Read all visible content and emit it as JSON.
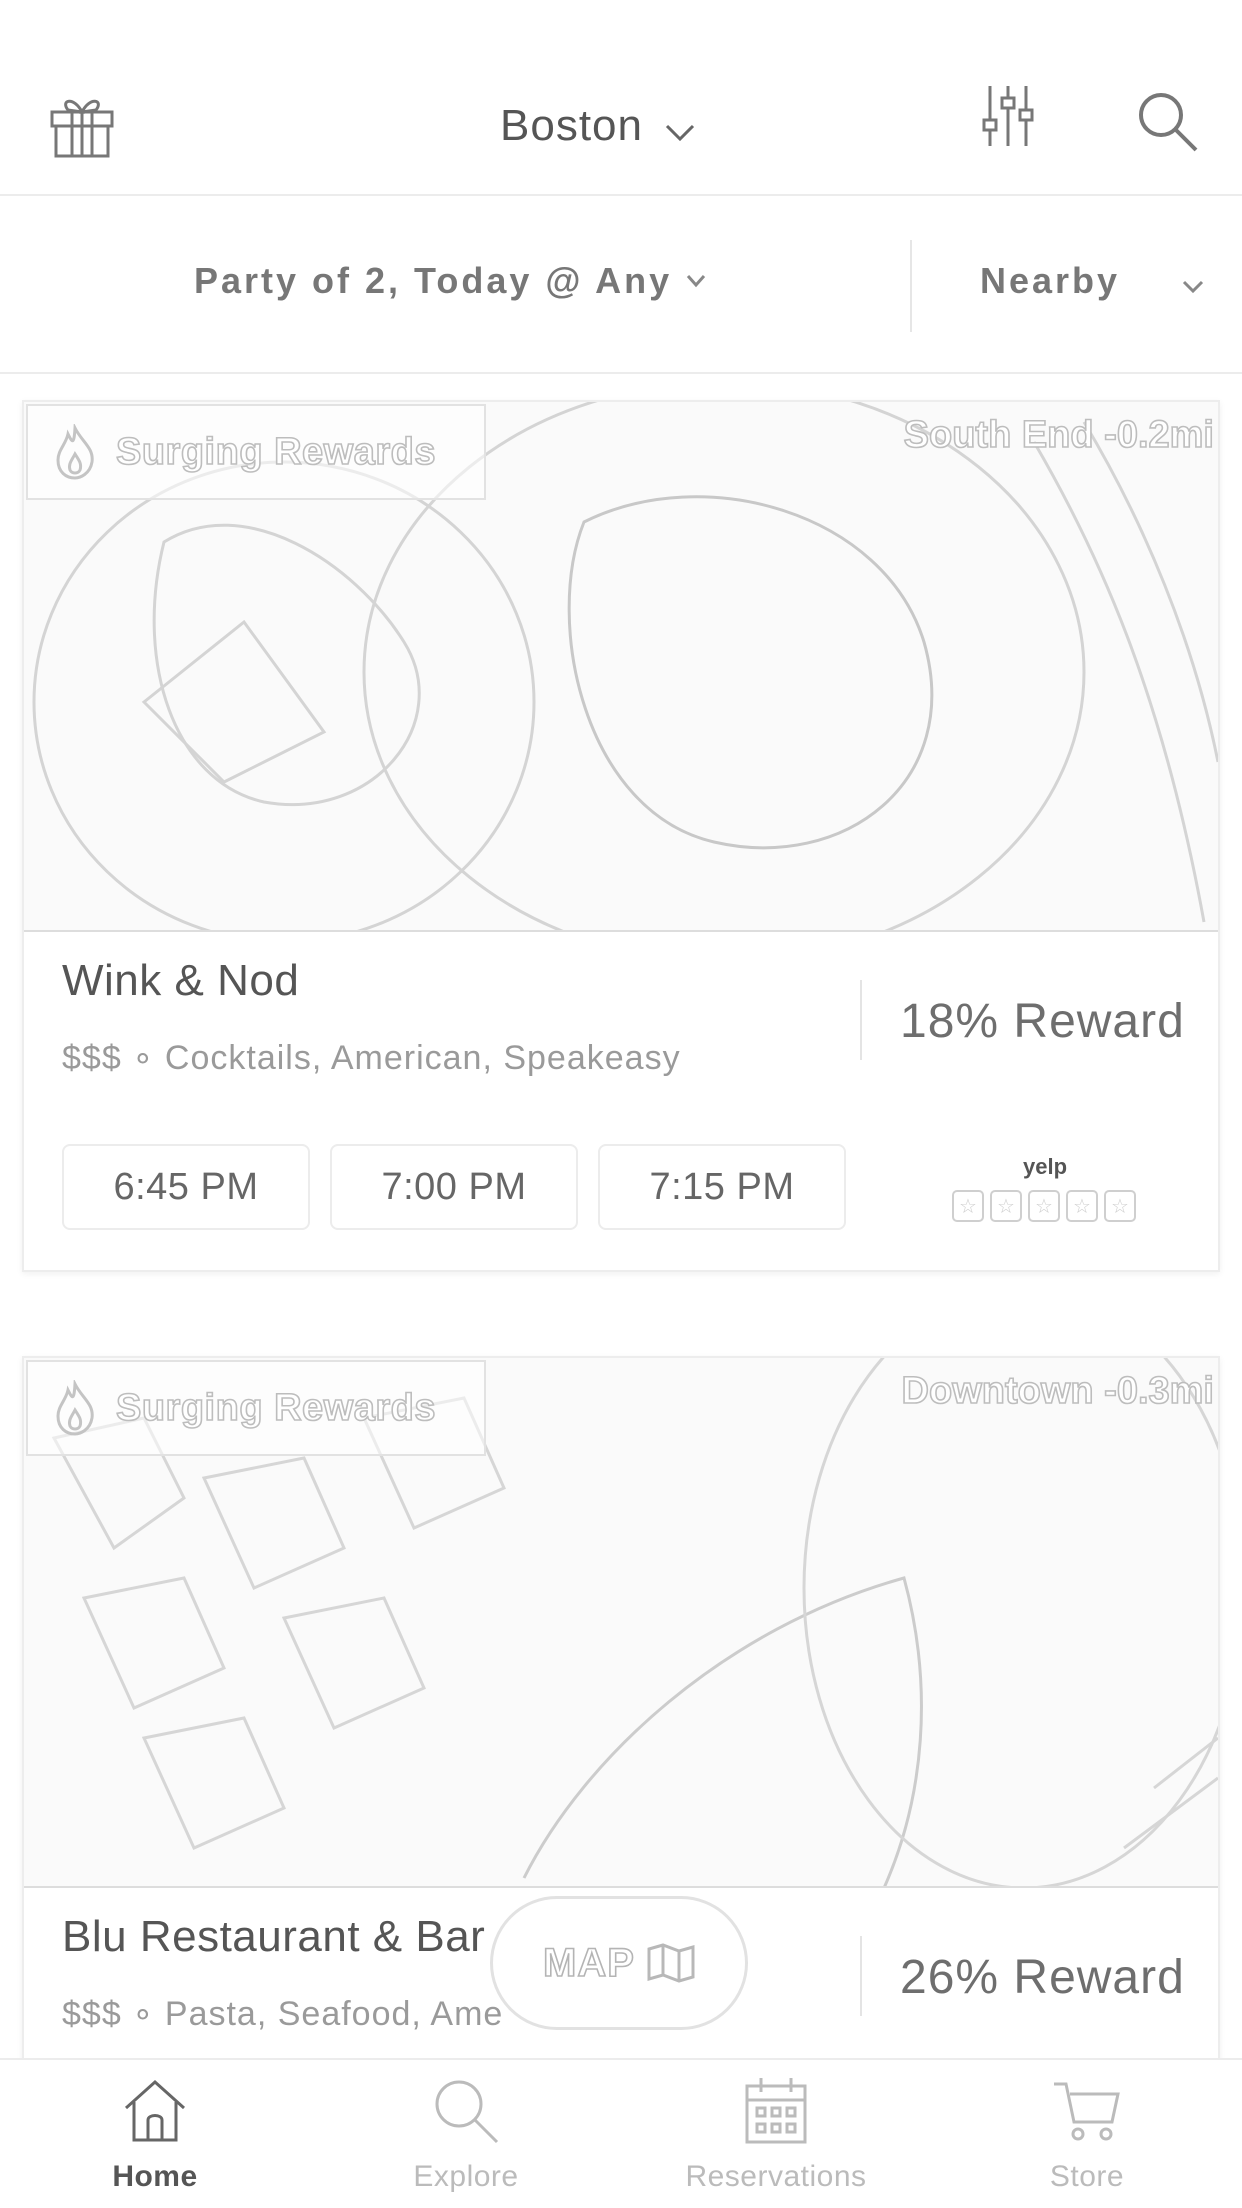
{
  "header": {
    "city": "Boston",
    "icons": [
      "gift-icon",
      "chevron-down-icon",
      "filters-icon",
      "search-icon"
    ]
  },
  "filters": {
    "party": "Party of 2, Today @ Any",
    "sort": "Nearby"
  },
  "restaurants": [
    {
      "badge": "Surging Rewards",
      "neighborhood": "South End -0.2mi",
      "name": "Wink & Nod",
      "meta": "$$$ ∘ Cocktails, American, Speakeasy",
      "reward": "18% Reward",
      "times": [
        "6:45 PM",
        "7:00 PM",
        "7:15 PM"
      ],
      "yelp": "yelp",
      "rating": 0
    },
    {
      "badge": "Surging Rewards",
      "neighborhood": "Downtown -0.3mi",
      "name": "Blu Restaurant & Bar",
      "meta": "$$$ ∘ Pasta, Seafood, Ame",
      "reward": "26% Reward"
    }
  ],
  "map_button": {
    "label": "MAP"
  },
  "tabs": [
    {
      "label": "Home",
      "icon": "home-icon",
      "active": true
    },
    {
      "label": "Explore",
      "icon": "search-icon",
      "active": false
    },
    {
      "label": "Reservations",
      "icon": "calendar-icon",
      "active": false
    },
    {
      "label": "Store",
      "icon": "cart-icon",
      "active": false
    }
  ],
  "colors": {
    "text": "#555555",
    "muted": "#9a9a9a",
    "border": "#ececec"
  }
}
